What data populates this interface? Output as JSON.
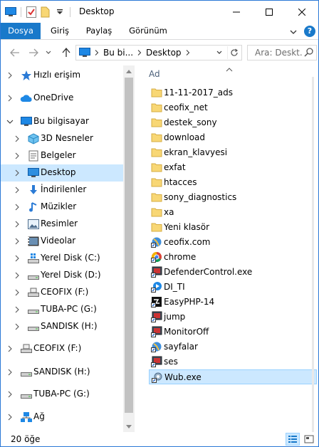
{
  "window": {
    "title": "Desktop"
  },
  "ribbon": {
    "tabs": [
      "Dosya",
      "Giriş",
      "Paylaş",
      "Görünüm"
    ]
  },
  "address": {
    "crumbs": [
      "Bu bi...",
      "Desktop"
    ],
    "search_placeholder": "Ara: Deskt..."
  },
  "nav": {
    "items": [
      {
        "label": "Hızlı erişim",
        "icon": "star-icon"
      },
      {
        "label": "OneDrive",
        "icon": "cloud-icon"
      },
      {
        "label": "Bu bilgisayar",
        "icon": "computer-icon"
      },
      {
        "label": "3D Nesneler",
        "icon": "cube-icon"
      },
      {
        "label": "Belgeler",
        "icon": "documents-icon"
      },
      {
        "label": "Desktop",
        "icon": "desktop-icon"
      },
      {
        "label": "İndirilenler",
        "icon": "download-icon"
      },
      {
        "label": "Müzikler",
        "icon": "music-icon"
      },
      {
        "label": "Resimler",
        "icon": "pictures-icon"
      },
      {
        "label": "Videolar",
        "icon": "video-icon"
      },
      {
        "label": "Yerel Disk (C:)",
        "icon": "windows-drive-icon"
      },
      {
        "label": "Yerel Disk (D:)",
        "icon": "drive-icon"
      },
      {
        "label": "CEOFIX (F:)",
        "icon": "usb-drive-icon"
      },
      {
        "label": "TUBA-PC (G:)",
        "icon": "drive-icon"
      },
      {
        "label": "SANDISK (H:)",
        "icon": "drive-icon"
      },
      {
        "label": "CEOFIX (F:)",
        "icon": "usb-drive-icon"
      },
      {
        "label": "SANDISK (H:)",
        "icon": "drive-icon"
      },
      {
        "label": "TUBA-PC (G:)",
        "icon": "drive-icon"
      },
      {
        "label": "Ağ",
        "icon": "network-icon"
      }
    ],
    "selected": "Desktop"
  },
  "files": {
    "column_header": "Ad",
    "items": [
      {
        "name": "11-11-2017_ads",
        "type": "folder"
      },
      {
        "name": "ceofix_net",
        "type": "folder"
      },
      {
        "name": "destek_sony",
        "type": "folder"
      },
      {
        "name": "download",
        "type": "folder"
      },
      {
        "name": "ekran_klavyesi",
        "type": "folder"
      },
      {
        "name": "exfat",
        "type": "folder"
      },
      {
        "name": "htacces",
        "type": "folder"
      },
      {
        "name": "sony_diagnostics",
        "type": "folder"
      },
      {
        "name": "xa",
        "type": "folder"
      },
      {
        "name": "Yeni klasör",
        "type": "folder"
      },
      {
        "name": "ceofix.com",
        "type": "shortcut-web"
      },
      {
        "name": "chrome",
        "type": "shortcut-chrome"
      },
      {
        "name": "DefenderControl.exe",
        "type": "shortcut-app"
      },
      {
        "name": "DI_TI",
        "type": "shortcut-blue"
      },
      {
        "name": "EasyPHP-14",
        "type": "shortcut-php"
      },
      {
        "name": "jump",
        "type": "shortcut-app"
      },
      {
        "name": "MonitorOff",
        "type": "shortcut-app"
      },
      {
        "name": "sayfalar",
        "type": "shortcut-web"
      },
      {
        "name": "ses",
        "type": "shortcut-app"
      },
      {
        "name": "Wub.exe",
        "type": "shortcut-gear"
      }
    ]
  },
  "status": {
    "count_text": "20 öğe"
  },
  "colors": {
    "accent": "#1979ca",
    "selection": "#cce8ff",
    "folder": "#f8d775"
  }
}
